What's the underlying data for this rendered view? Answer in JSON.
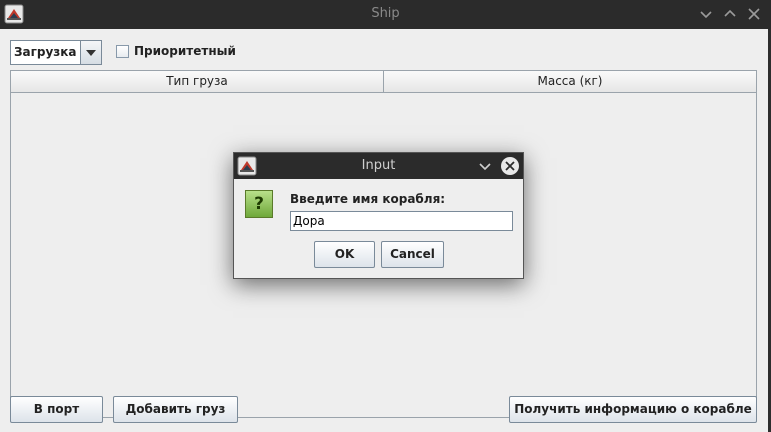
{
  "window": {
    "title": "Ship"
  },
  "toolbar": {
    "mode_select": {
      "value": "Загрузка"
    },
    "priority_checkbox": {
      "label": "Приоритетный",
      "checked": false
    }
  },
  "table": {
    "columns": [
      "Тип груза",
      "Масса (кг)"
    ],
    "rows": []
  },
  "buttons": {
    "to_port": "В порт",
    "add_cargo": "Добавить груз",
    "ship_info": "Получить информацию о корабле"
  },
  "dialog": {
    "title": "Input",
    "prompt": "Введите имя корабля:",
    "input_value": "Дора",
    "ok_label": "OK",
    "cancel_label": "Cancel"
  },
  "colors": {
    "titlebar": "#2b2b2b",
    "background": "#eeeeee",
    "question_icon": "#7fb446"
  }
}
